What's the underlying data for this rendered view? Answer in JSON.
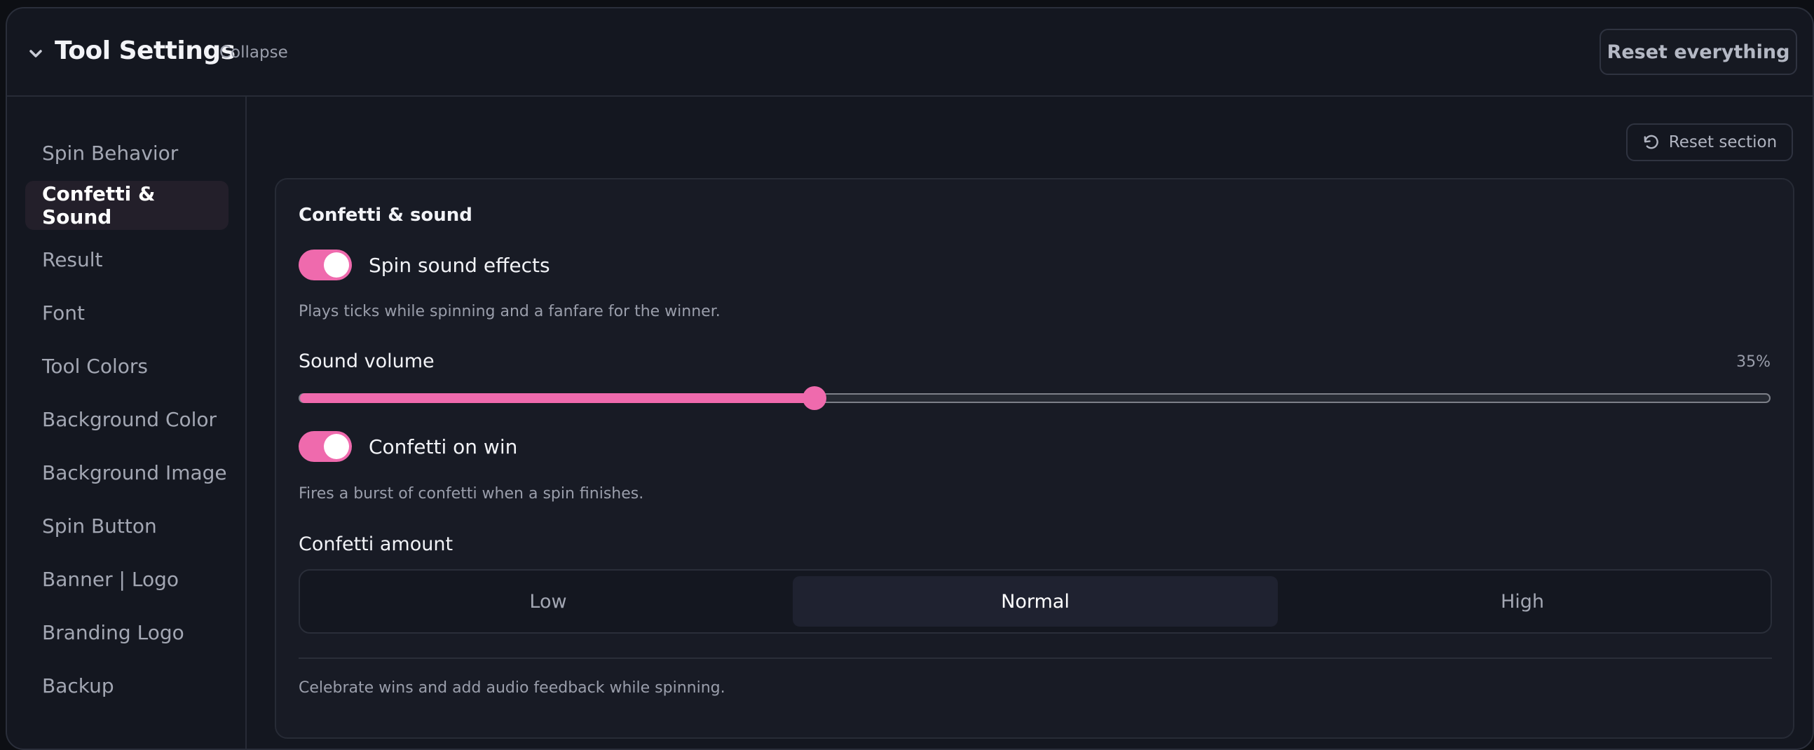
{
  "header": {
    "title": "Tool Settings",
    "collapse_label": "Collapse",
    "reset_everything_label": "Reset everything",
    "collapse_icon": "chevron-down-icon"
  },
  "sidebar": {
    "items": [
      {
        "label": "Spin Behavior",
        "active": false
      },
      {
        "label": "Confetti & Sound",
        "active": true
      },
      {
        "label": "Result",
        "active": false
      },
      {
        "label": "Font",
        "active": false
      },
      {
        "label": "Tool Colors",
        "active": false
      },
      {
        "label": "Background Color",
        "active": false
      },
      {
        "label": "Background Image",
        "active": false
      },
      {
        "label": "Spin Button",
        "active": false
      },
      {
        "label": "Banner | Logo",
        "active": false
      },
      {
        "label": "Branding Logo",
        "active": false
      },
      {
        "label": "Backup",
        "active": false
      }
    ]
  },
  "section": {
    "reset_label": "Reset section",
    "reset_icon": "rotate-ccw-icon",
    "card_title": "Confetti & sound",
    "spin_sound": {
      "label": "Spin sound effects",
      "enabled": true,
      "help": "Plays ticks while spinning and a fanfare for the winner."
    },
    "volume": {
      "label": "Sound volume",
      "value_text": "35%",
      "value": 0.35
    },
    "confetti": {
      "label": "Confetti on win",
      "enabled": true,
      "help": "Fires a burst of confetti when a spin finishes."
    },
    "confetti_amount": {
      "label": "Confetti amount",
      "options": [
        "Low",
        "Normal",
        "High"
      ],
      "selected": "Normal"
    },
    "footer": "Celebrate wins and add audio feedback while spinning."
  },
  "colors": {
    "accent": "#ef6aad",
    "background": "#141720",
    "card": "#181b25"
  }
}
